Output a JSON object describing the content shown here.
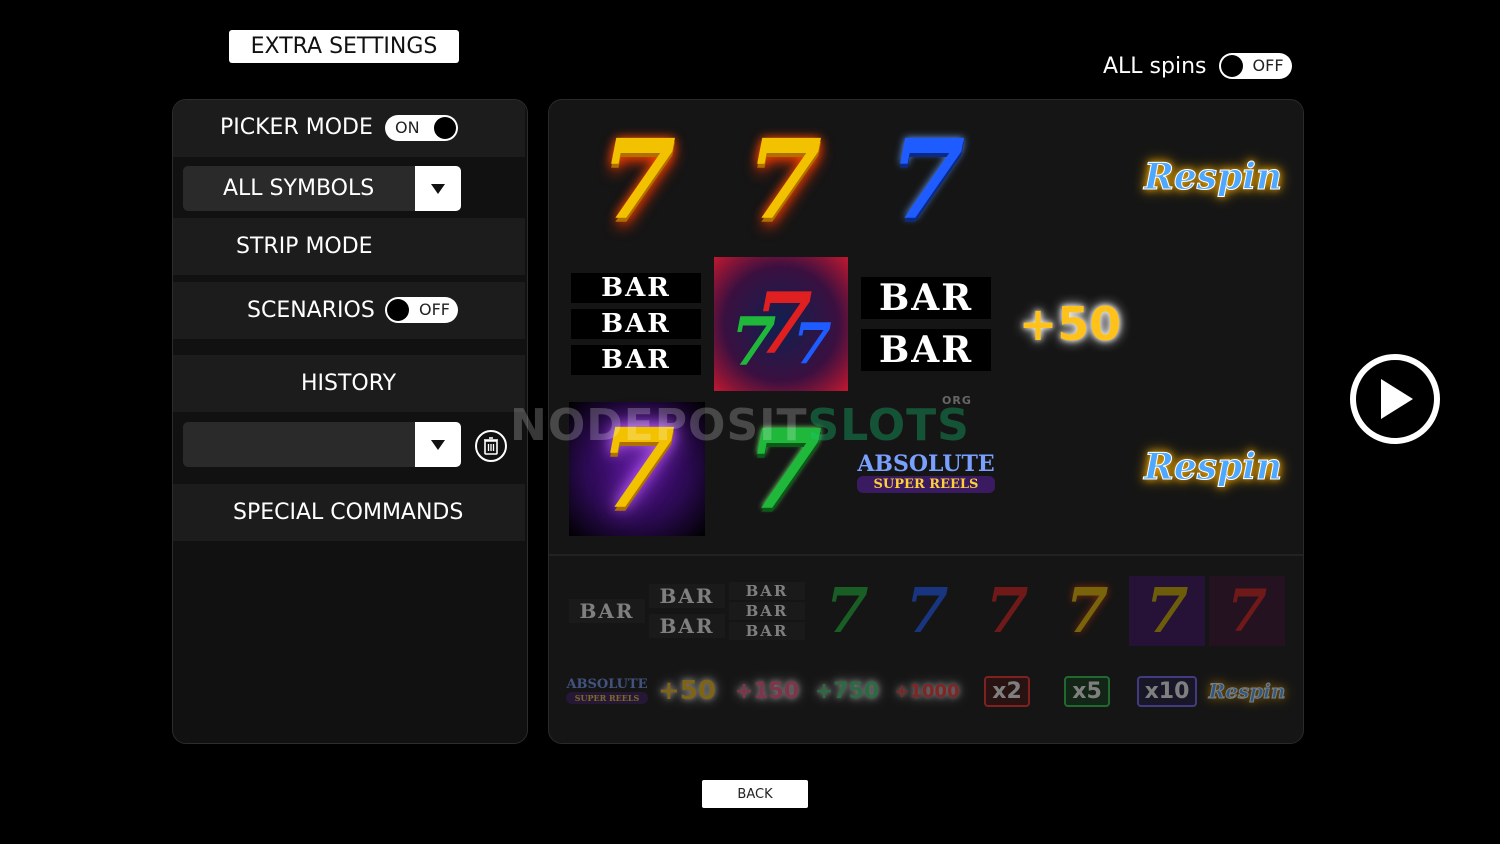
{
  "header": {
    "title": "EXTRA SETTINGS"
  },
  "all_spins": {
    "label": "ALL spins",
    "state": "OFF"
  },
  "left_panel": {
    "picker_mode": {
      "label": "PICKER MODE",
      "state": "ON"
    },
    "symbol_filter": {
      "selected": "ALL SYMBOLS"
    },
    "strip_mode": {
      "label": "STRIP MODE"
    },
    "scenarios": {
      "label": "SCENARIOS",
      "state": "OFF"
    },
    "history": {
      "label": "HISTORY",
      "selected": ""
    },
    "special_commands": {
      "label": "SPECIAL COMMANDS"
    }
  },
  "reels": {
    "row1": [
      {
        "type": "seven",
        "char": "7",
        "color": "#f2c200",
        "glow": "#ff4a00"
      },
      {
        "type": "seven",
        "char": "7",
        "color": "#f2c200",
        "glow": "#ff4a00"
      },
      {
        "type": "seven",
        "char": "7",
        "color": "#1f5cff",
        "glow": "#0a2a8a"
      },
      {
        "type": "respin",
        "text": "Respin"
      }
    ],
    "row2": [
      {
        "type": "bar3",
        "text": "BAR"
      },
      {
        "type": "triple-seven",
        "char": "7"
      },
      {
        "type": "bar2",
        "text": "BAR"
      },
      {
        "type": "bonus",
        "text": "+50"
      }
    ],
    "row3": [
      {
        "type": "seven",
        "char": "7",
        "color": "#f2c200",
        "glow": "#b040ff"
      },
      {
        "type": "seven",
        "char": "7",
        "color": "#1fb83a",
        "glow": "#0a5a18"
      },
      {
        "type": "logo",
        "title": "ABSOLUTE",
        "subtitle": "SUPER REELS"
      },
      {
        "type": "respin",
        "text": "Respin"
      }
    ]
  },
  "palette": {
    "row1": [
      {
        "kind": "bar1",
        "text": "BAR"
      },
      {
        "kind": "bar2",
        "text": "BAR"
      },
      {
        "kind": "bar3",
        "text": "BAR"
      },
      {
        "kind": "seven",
        "char": "7",
        "color": "#1fb83a"
      },
      {
        "kind": "seven",
        "char": "7",
        "color": "#1f5cff"
      },
      {
        "kind": "seven",
        "char": "7",
        "color": "#e02020"
      },
      {
        "kind": "seven",
        "char": "7",
        "color": "#f2c200"
      },
      {
        "kind": "seven",
        "char": "7",
        "color": "#d9b400"
      },
      {
        "kind": "seven",
        "char": "7",
        "color": "#e02020"
      }
    ],
    "row2": [
      {
        "kind": "logo",
        "text": "ABSOLUTE",
        "sub": "SUPER REELS"
      },
      {
        "kind": "bonus",
        "text": "+50",
        "color": "#ffc21a"
      },
      {
        "kind": "bonus",
        "text": "+150",
        "color": "#ff5a8a"
      },
      {
        "kind": "bonus",
        "text": "+750",
        "color": "#4ad07a"
      },
      {
        "kind": "bonus",
        "text": "+1000",
        "color": "#ff3a3a"
      },
      {
        "kind": "mult",
        "text": "x2",
        "color": "#ff3030"
      },
      {
        "kind": "mult",
        "text": "x5",
        "color": "#30d050"
      },
      {
        "kind": "mult",
        "text": "x10",
        "color": "#7a6aff"
      },
      {
        "kind": "respin",
        "text": "Respin"
      }
    ]
  },
  "watermark": {
    "part1": "NODEPOSIT",
    "part2": "SLOTS",
    "suffix": "ORG"
  },
  "controls": {
    "back_label": "BACK",
    "play": "play-icon"
  }
}
